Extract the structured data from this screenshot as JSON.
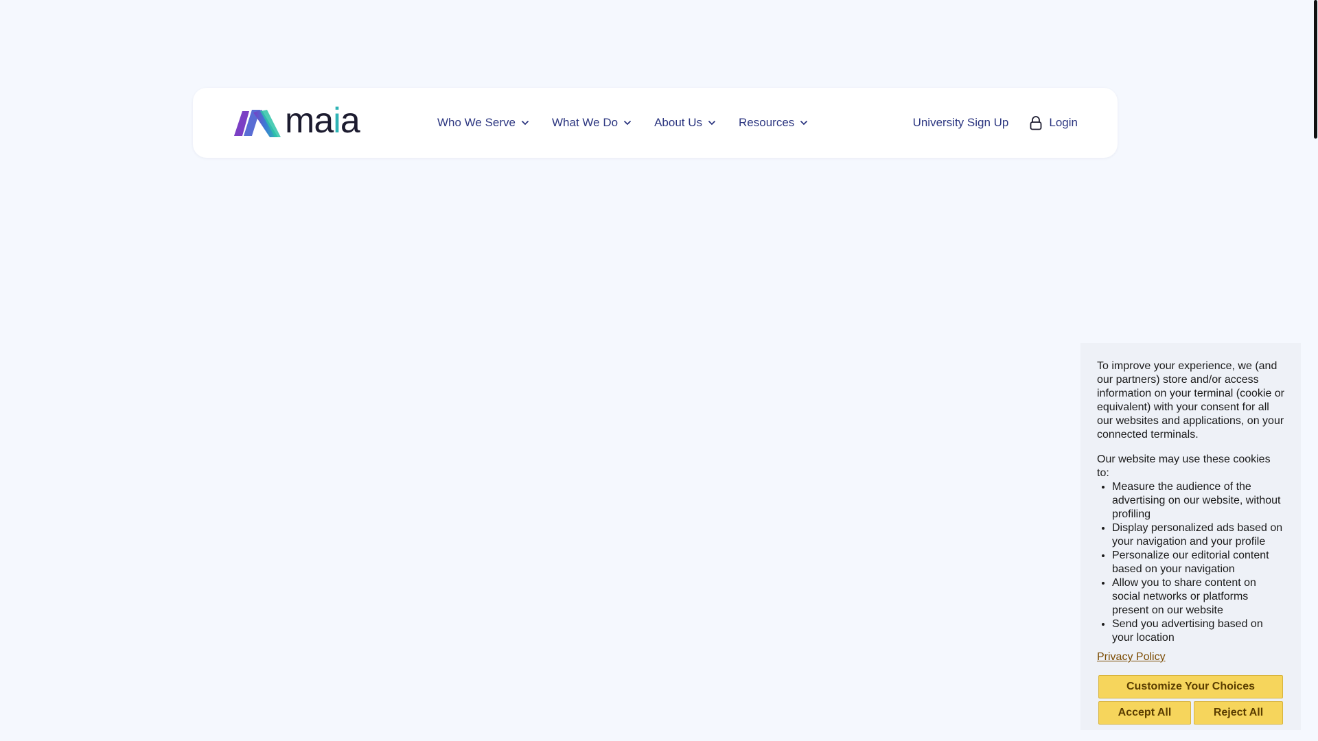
{
  "header": {
    "logo": {
      "text_pre": "ma",
      "text_accent": "i",
      "text_post": "a",
      "icon": "maia-logo-icon"
    },
    "nav_items": [
      {
        "label": "Who We Serve",
        "icon": "chevron-down-icon"
      },
      {
        "label": "What We Do",
        "icon": "chevron-down-icon"
      },
      {
        "label": "About Us",
        "icon": "chevron-down-icon"
      },
      {
        "label": "Resources",
        "icon": "chevron-down-icon"
      }
    ],
    "signup_label": "University Sign Up",
    "login_label": "Login",
    "login_icon": "lock-icon"
  },
  "cookie": {
    "intro": "To improve your experience, we (and our partners) store and/or access information on your terminal (cookie or equivalent) with your consent for all our websites and applications, on your connected terminals.",
    "list_intro": "Our website may use these cookies to:",
    "items": [
      "Measure the audience of the advertising on our website, without profiling",
      "Display personalized ads based on your navigation and your profile",
      "Personalize our editorial content based on your navigation",
      "Allow you to share content on social networks or platforms present on our website",
      "Send you advertising based on your location"
    ],
    "privacy_link": "Privacy Policy",
    "customize_label": "Customize Your Choices",
    "accept_label": "Accept All",
    "reject_label": "Reject All"
  },
  "colors": {
    "background": "#f5f8fe",
    "nav_text": "#2c3680",
    "button": "#f6d55c",
    "logo_accent": "#2fb3b5"
  }
}
